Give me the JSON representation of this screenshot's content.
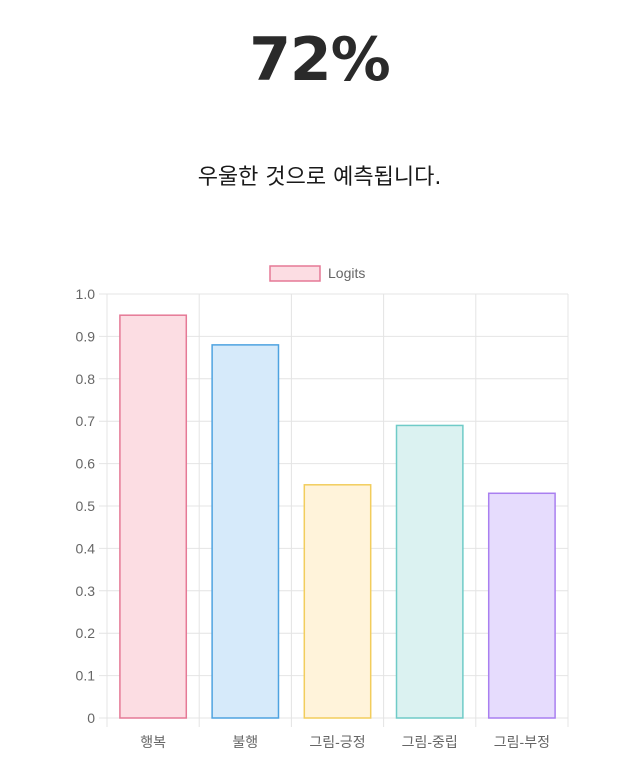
{
  "headline": {
    "percent": "72%"
  },
  "result": {
    "message": "우울한 것으로 예측됩니다."
  },
  "chart_data": {
    "type": "bar",
    "categories": [
      "행복",
      "불행",
      "그림-긍정",
      "그림-중립",
      "그림-부정"
    ],
    "series": [
      {
        "name": "Logits",
        "values": [
          0.95,
          0.88,
          0.55,
          0.69,
          0.53
        ]
      }
    ],
    "y_ticks": [
      "0",
      "0.1",
      "0.2",
      "0.3",
      "0.4",
      "0.5",
      "0.6",
      "0.7",
      "0.8",
      "0.9",
      "1.0"
    ],
    "ylim": [
      0,
      1.0
    ],
    "grid": true,
    "legend_position": "top",
    "bar_fills": [
      "#fcdde3",
      "#d6eafa",
      "#fff3da",
      "#dbf2f1",
      "#e6dcfd"
    ],
    "bar_strokes": [
      "#e57996",
      "#4ea3e0",
      "#f2cd5c",
      "#6fcbc7",
      "#a97ff0"
    ],
    "legend_fill": "#fcdde3",
    "legend_stroke": "#e57996",
    "grid_color": "#e4e4e4"
  }
}
